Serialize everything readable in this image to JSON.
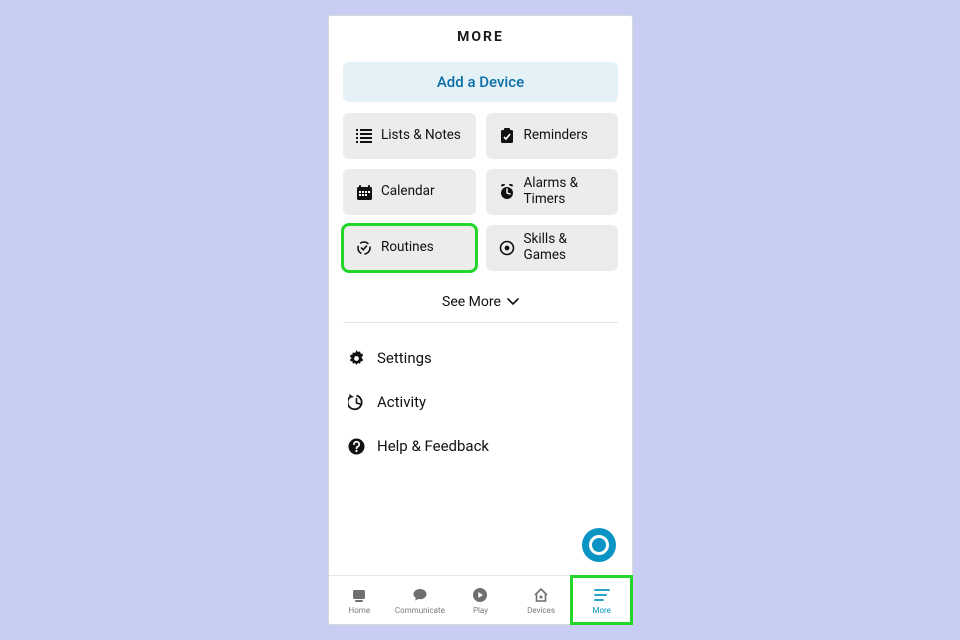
{
  "header": {
    "title": "MORE"
  },
  "add_device": {
    "label": "Add a Device"
  },
  "grid": {
    "items": [
      {
        "label": "Lists & Notes",
        "icon": "list-icon"
      },
      {
        "label": "Reminders",
        "icon": "reminders-icon"
      },
      {
        "label": "Calendar",
        "icon": "calendar-icon"
      },
      {
        "label": "Alarms & Timers",
        "icon": "alarm-icon"
      },
      {
        "label": "Routines",
        "icon": "routines-icon",
        "highlight": true
      },
      {
        "label": "Skills & Games",
        "icon": "skills-icon"
      }
    ]
  },
  "see_more": {
    "label": "See More"
  },
  "settings": {
    "items": [
      {
        "label": "Settings",
        "icon": "gear-icon"
      },
      {
        "label": "Activity",
        "icon": "activity-icon"
      },
      {
        "label": "Help & Feedback",
        "icon": "help-icon"
      }
    ]
  },
  "tabs": {
    "items": [
      {
        "label": "Home",
        "icon": "home-tab-icon",
        "active": false
      },
      {
        "label": "Communicate",
        "icon": "communicate-tab-icon",
        "active": false
      },
      {
        "label": "Play",
        "icon": "play-tab-icon",
        "active": false
      },
      {
        "label": "Devices",
        "icon": "devices-tab-icon",
        "active": false
      },
      {
        "label": "More",
        "icon": "more-tab-icon",
        "active": true,
        "highlight": true
      }
    ]
  },
  "colors": {
    "highlight": "#23d62a",
    "accent": "#0a94c4",
    "add_device_bg": "#e4f2f7",
    "card_bg": "#ececec"
  }
}
